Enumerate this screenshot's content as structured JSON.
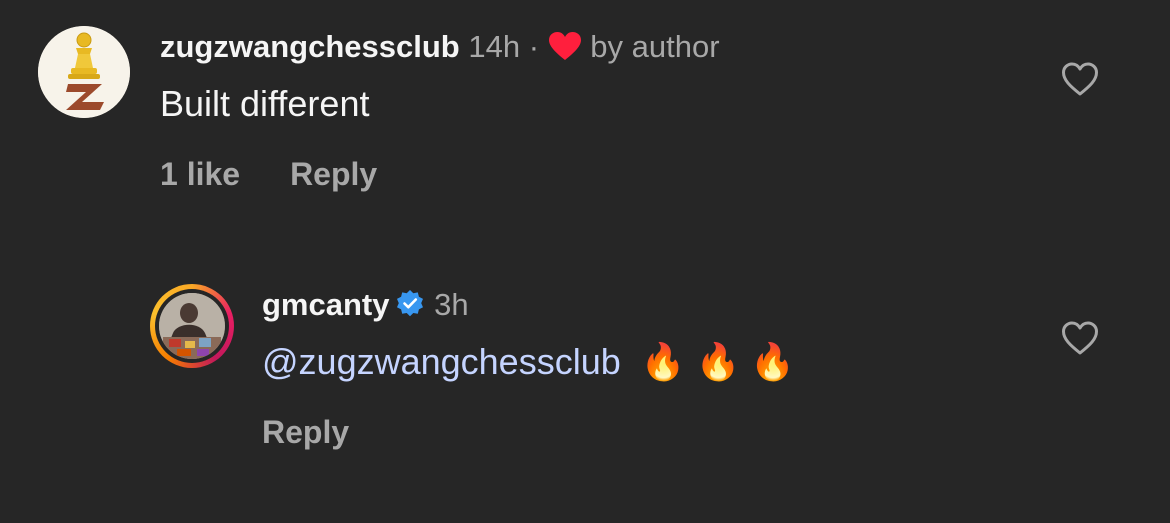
{
  "comments": [
    {
      "username": "zugzwangchessclub",
      "time": "14h",
      "separator": "·",
      "liked_label": "by author",
      "text": "Built different",
      "likes": "1 like",
      "reply": "Reply"
    },
    {
      "username": "gmcanty",
      "time": "3h",
      "mention": "@zugzwangchessclub",
      "emojis": "🔥 🔥 🔥",
      "reply": "Reply"
    }
  ],
  "colors": {
    "background": "#262626",
    "primary_text": "#f5f5f5",
    "secondary_text": "#a8a8a8",
    "mention": "#c5d4ff",
    "author_heart": "#ff1f3d",
    "verified": "#3897f0"
  },
  "icons": {
    "like": "heart-outline-icon",
    "author_like": "heart-filled-icon",
    "verified": "verified-badge-icon"
  }
}
